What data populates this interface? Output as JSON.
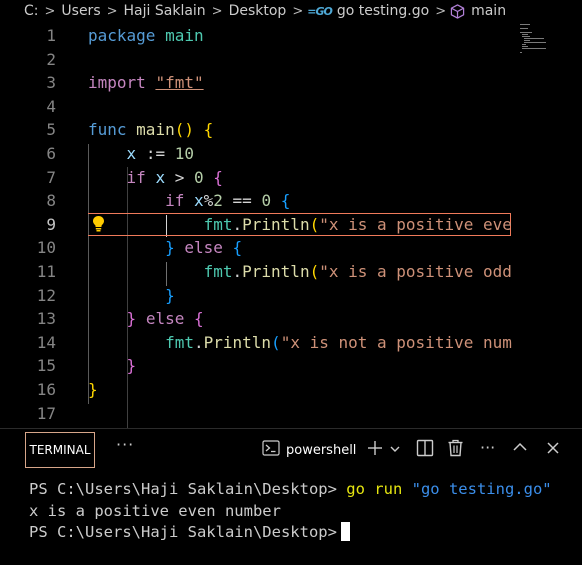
{
  "breadcrumb": {
    "items": [
      "C:",
      "Users",
      "Haji Saklain",
      "Desktop",
      "go testing.go",
      "main"
    ]
  },
  "editor": {
    "line_numbers": [
      "1",
      "2",
      "3",
      "4",
      "5",
      "6",
      "7",
      "8",
      "9",
      "10",
      "11",
      "12",
      "13",
      "14",
      "15",
      "16",
      "17"
    ],
    "active_line": "9",
    "tokens": {
      "l1_kw": "package",
      "l1_name": "main",
      "l3_kw": "import",
      "l3_str": "\"fmt\"",
      "l5_kw": "func",
      "l5_name": "main",
      "l5_paren": "()",
      "l5_brace": "{",
      "l6_var": "x",
      "l6_op": ":=",
      "l6_num": "10",
      "l7_kw": "if",
      "l7_var": "x",
      "l7_op": ">",
      "l7_num": "0",
      "l7_brace": "{",
      "l8_kw": "if",
      "l8_var": "x",
      "l8_op": "%",
      "l8_num1": "2",
      "l8_eq": "==",
      "l8_num2": "0",
      "l8_brace": "{",
      "l9_pkg": "fmt",
      "l9_dot": ".",
      "l9_fn": "Println",
      "l9_paren": "(",
      "l9_str": "\"x is a positive eve",
      "l10_brace": "}",
      "l10_kw": "else",
      "l10_brace2": "{",
      "l11_pkg": "fmt",
      "l11_dot": ".",
      "l11_fn": "Println",
      "l11_paren": "(",
      "l11_str": "\"x is a positive odd",
      "l12_brace": "}",
      "l13_brace": "}",
      "l13_kw": "else",
      "l13_brace2": "{",
      "l14_pkg": "fmt",
      "l14_dot": ".",
      "l14_fn": "Println",
      "l14_paren": "(",
      "l14_str": "\"x is not a positive num",
      "l15_brace": "}",
      "l16_brace": "}"
    }
  },
  "terminal": {
    "tab_label": "TERMINAL",
    "more_label": "···",
    "shell_label": "powershell",
    "lines": {
      "prompt1": "PS C:\\Users\\Haji Saklain\\Desktop>",
      "cmd": "go run",
      "arg": "\"go testing.go\"",
      "output": "x is a positive even number",
      "prompt2": "PS C:\\Users\\Haji Saklain\\Desktop>"
    }
  },
  "colors": {
    "background": "#000000",
    "keyword": "#569cd6",
    "control": "#c586c0",
    "function": "#dcdcaa",
    "string": "#ce9178",
    "number": "#b5cea8",
    "variable": "#9cdcfe",
    "package": "#4ec9b0",
    "bracket_level1": "#ffd700",
    "bracket_level2": "#da70d6",
    "bracket_level3": "#179fff",
    "active_line_border": "#f07a5a",
    "lightbulb": "#ffcc00"
  },
  "icons": [
    "chevron-right-icon",
    "go-file-icon",
    "symbol-cube-icon",
    "lightbulb-icon",
    "terminal-icon",
    "plus-icon",
    "chevron-down-icon",
    "split-icon",
    "trash-icon",
    "ellipsis-icon",
    "chevron-up-icon",
    "close-icon"
  ]
}
